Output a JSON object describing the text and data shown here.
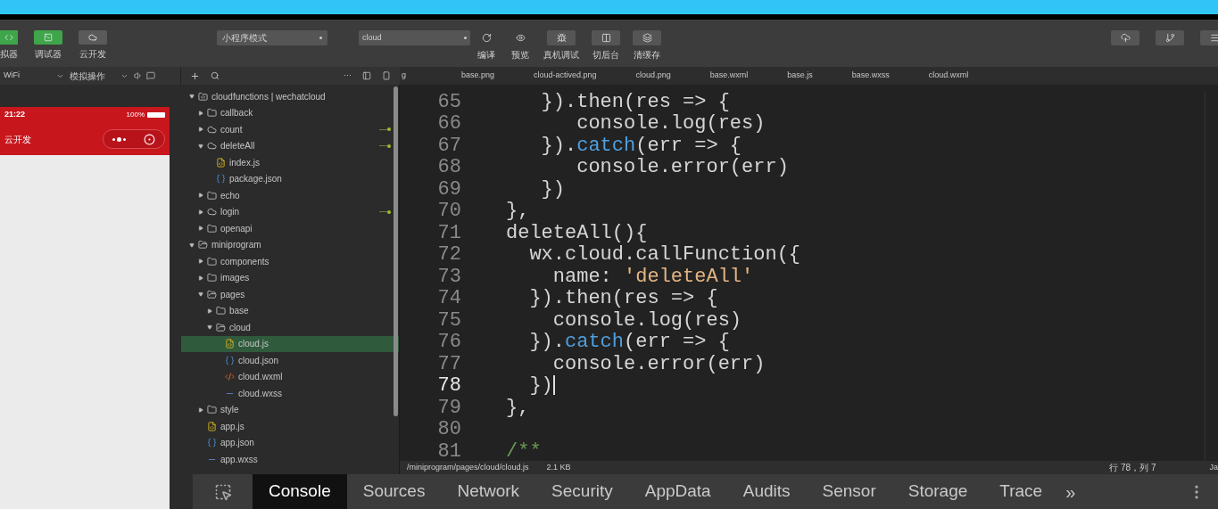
{
  "toolbar": {
    "mode_buttons": [
      {
        "label": "拟器",
        "active": true
      },
      {
        "label": "调试器",
        "active": true
      },
      {
        "label": "云开发",
        "active": false
      }
    ],
    "mode_select": {
      "value": "小程序模式"
    },
    "compile_select": {
      "value": "cloud"
    },
    "actions": [
      {
        "label": "编译",
        "kind": "plain"
      },
      {
        "label": "预览",
        "kind": "plain"
      },
      {
        "label": "真机调试",
        "kind": "boxed"
      },
      {
        "label": "切后台",
        "kind": "boxed"
      },
      {
        "label": "清缓存",
        "kind": "boxed"
      }
    ]
  },
  "simulator_bar": {
    "network": "WiFi",
    "operation": "模拟操作"
  },
  "tree_toolbar": {
    "more": "···"
  },
  "file_tabs": [
    {
      "label": "g",
      "selected": false
    },
    {
      "label": "base.png",
      "selected": false
    },
    {
      "label": "cloud-actived.png",
      "selected": false
    },
    {
      "label": "cloud.png",
      "selected": false
    },
    {
      "label": "base.wxml",
      "selected": false
    },
    {
      "label": "base.js",
      "selected": false
    },
    {
      "label": "base.wxss",
      "selected": false
    },
    {
      "label": "cloud.wxml",
      "selected": false
    }
  ],
  "phone": {
    "time": "21:22",
    "battery": "100%",
    "title": "云开发"
  },
  "tree": [
    {
      "label": "cloudfunctions | wechatcloud",
      "kind": "root",
      "expanded": true,
      "selected": false,
      "children": [
        {
          "label": "callback",
          "kind": "folder",
          "expanded": false,
          "selected": false
        },
        {
          "label": "count",
          "kind": "cloud",
          "expanded": false,
          "selected": false,
          "uploaded": true
        },
        {
          "label": "deleteAll",
          "kind": "cloud",
          "expanded": true,
          "selected": false,
          "uploaded": true,
          "children": [
            {
              "label": "index.js",
              "kind": "js",
              "selected": false
            },
            {
              "label": "package.json",
              "kind": "json",
              "selected": false
            }
          ]
        },
        {
          "label": "echo",
          "kind": "folder",
          "expanded": false,
          "selected": false
        },
        {
          "label": "login",
          "kind": "cloud",
          "expanded": false,
          "selected": false,
          "uploaded": true
        },
        {
          "label": "openapi",
          "kind": "folder",
          "expanded": false,
          "selected": false
        }
      ]
    },
    {
      "label": "miniprogram",
      "kind": "folder",
      "expanded": true,
      "selected": false,
      "children": [
        {
          "label": "components",
          "kind": "folder",
          "expanded": false,
          "selected": false
        },
        {
          "label": "images",
          "kind": "folder",
          "expanded": false,
          "selected": false
        },
        {
          "label": "pages",
          "kind": "folder",
          "expanded": true,
          "selected": false,
          "children": [
            {
              "label": "base",
              "kind": "folder",
              "expanded": false,
              "selected": false
            },
            {
              "label": "cloud",
              "kind": "folder",
              "expanded": true,
              "selected": false,
              "children": [
                {
                  "label": "cloud.js",
                  "kind": "js",
                  "selected": true
                },
                {
                  "label": "cloud.json",
                  "kind": "json",
                  "selected": false
                },
                {
                  "label": "cloud.wxml",
                  "kind": "wxml",
                  "selected": false
                },
                {
                  "label": "cloud.wxss",
                  "kind": "wxss",
                  "selected": false
                }
              ]
            }
          ]
        },
        {
          "label": "style",
          "kind": "folder",
          "expanded": false,
          "selected": false
        },
        {
          "label": "app.js",
          "kind": "js",
          "selected": false
        },
        {
          "label": "app.json",
          "kind": "json",
          "selected": false
        },
        {
          "label": "app.wxss",
          "kind": "wxss",
          "selected": false
        }
      ]
    }
  ],
  "code": [
    {
      "number": "65",
      "current": false,
      "tokens": [
        {
          "t": "   }).then(res => {",
          "kind": "plain"
        }
      ]
    },
    {
      "number": "66",
      "current": false,
      "tokens": [
        {
          "t": "      console.log(res)",
          "kind": "plain"
        }
      ]
    },
    {
      "number": "67",
      "current": false,
      "tokens": [
        {
          "t": "   }).",
          "kind": "plain"
        },
        {
          "t": "catch",
          "kind": "keyword"
        },
        {
          "t": "(err => {",
          "kind": "plain"
        }
      ]
    },
    {
      "number": "68",
      "current": false,
      "tokens": [
        {
          "t": "      console.error(err)",
          "kind": "plain"
        }
      ]
    },
    {
      "number": "69",
      "current": false,
      "tokens": [
        {
          "t": "   })",
          "kind": "plain"
        }
      ]
    },
    {
      "number": "70",
      "current": false,
      "tokens": [
        {
          "t": "},",
          "kind": "plain"
        }
      ]
    },
    {
      "number": "71",
      "current": false,
      "tokens": [
        {
          "t": "deleteAll(){",
          "kind": "plain"
        }
      ]
    },
    {
      "number": "72",
      "current": false,
      "tokens": [
        {
          "t": "  wx.cloud.callFunction({",
          "kind": "plain"
        }
      ]
    },
    {
      "number": "73",
      "current": false,
      "tokens": [
        {
          "t": "    name: ",
          "kind": "plain"
        },
        {
          "t": "'deleteAll'",
          "kind": "string"
        }
      ]
    },
    {
      "number": "74",
      "current": false,
      "tokens": [
        {
          "t": "  }).then(res => {",
          "kind": "plain"
        }
      ]
    },
    {
      "number": "75",
      "current": false,
      "tokens": [
        {
          "t": "    console.log(res)",
          "kind": "plain"
        }
      ]
    },
    {
      "number": "76",
      "current": false,
      "tokens": [
        {
          "t": "  }).",
          "kind": "plain"
        },
        {
          "t": "catch",
          "kind": "keyword"
        },
        {
          "t": "(err => {",
          "kind": "plain"
        }
      ]
    },
    {
      "number": "77",
      "current": false,
      "tokens": [
        {
          "t": "    console.error(err)",
          "kind": "plain"
        }
      ]
    },
    {
      "number": "78",
      "current": true,
      "tokens": [
        {
          "t": "  })",
          "kind": "plain"
        }
      ]
    },
    {
      "number": "79",
      "current": false,
      "tokens": [
        {
          "t": "},",
          "kind": "plain"
        }
      ]
    },
    {
      "number": "80",
      "current": false
    },
    {
      "number": "81",
      "current": false,
      "tokens": [
        {
          "t": "/**",
          "kind": "comment"
        }
      ]
    }
  ],
  "status_bar": {
    "path": "/miniprogram/pages/cloud/cloud.js",
    "size": "2.1 KB",
    "position": "行 78，列 7",
    "language": "Ja"
  },
  "devtools_tabs": [
    {
      "label": "Console",
      "selected": true
    },
    {
      "label": "Sources",
      "selected": false
    },
    {
      "label": "Network",
      "selected": false
    },
    {
      "label": "Security",
      "selected": false
    },
    {
      "label": "AppData",
      "selected": false
    },
    {
      "label": "Audits",
      "selected": false
    },
    {
      "label": "Sensor",
      "selected": false
    },
    {
      "label": "Storage",
      "selected": false
    },
    {
      "label": "Trace",
      "selected": false
    }
  ],
  "devtools_more": "»"
}
